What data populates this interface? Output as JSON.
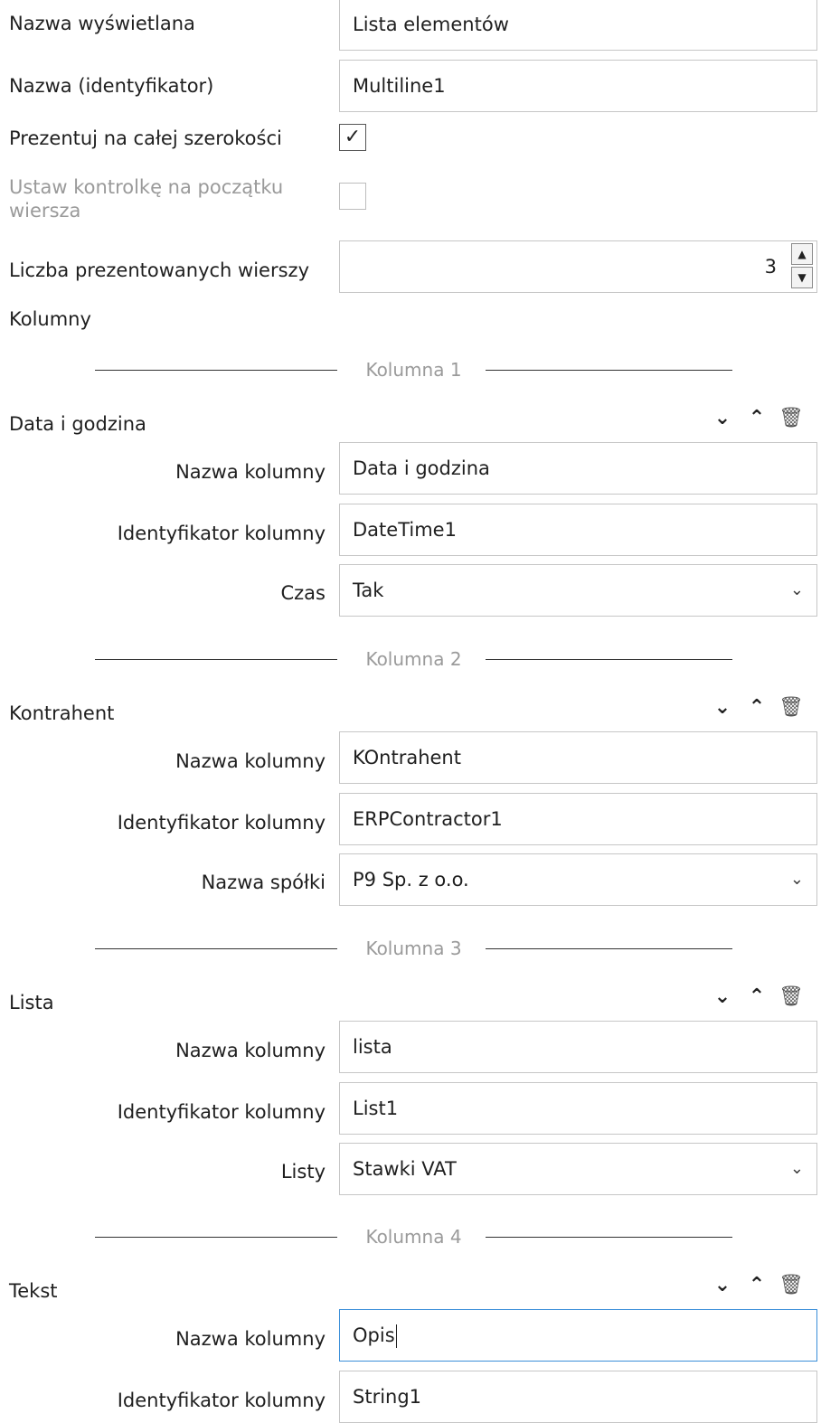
{
  "form": {
    "display_name_label": "Nazwa wyświetlana",
    "display_name_value": "Lista elementów",
    "id_label": "Nazwa (identyfikator)",
    "id_value": "Multiline1",
    "full_width_label": "Prezentuj na całej szerokości",
    "full_width_checked": true,
    "line_start_label_1": "Ustaw kontrolkę na początku",
    "line_start_label_2": "wiersza",
    "line_start_checked": false,
    "rows_label": "Liczba prezentowanych wierszy",
    "rows_value": "3",
    "columns_label": "Kolumny"
  },
  "icons": {
    "down": "chevron-down-icon",
    "up": "chevron-up-icon",
    "delete": "trash-icon",
    "select": "chevron-down-icon"
  },
  "columns": [
    {
      "separator": "Kolumna 1",
      "type": "Data i godzina",
      "name_label": "Nazwa kolumny",
      "name_value": "Data i godzina",
      "id_label": "Identyfikator kolumny",
      "id_value": "DateTime1",
      "extra_label": "Czas",
      "extra_value": "Tak"
    },
    {
      "separator": "Kolumna 2",
      "type": "Kontrahent",
      "name_label": "Nazwa kolumny",
      "name_value": "KOntrahent",
      "id_label": "Identyfikator kolumny",
      "id_value": "ERPContractor1",
      "extra_label": "Nazwa spółki",
      "extra_value": "P9 Sp. z o.o."
    },
    {
      "separator": "Kolumna 3",
      "type": "Lista",
      "name_label": "Nazwa kolumny",
      "name_value": "lista",
      "id_label": "Identyfikator kolumny",
      "id_value": "List1",
      "extra_label": "Listy",
      "extra_value": "Stawki VAT"
    },
    {
      "separator": "Kolumna 4",
      "type": "Tekst",
      "name_label": "Nazwa kolumny",
      "name_value": "Opis",
      "id_label": "Identyfikator kolumny",
      "id_value": "String1"
    }
  ]
}
